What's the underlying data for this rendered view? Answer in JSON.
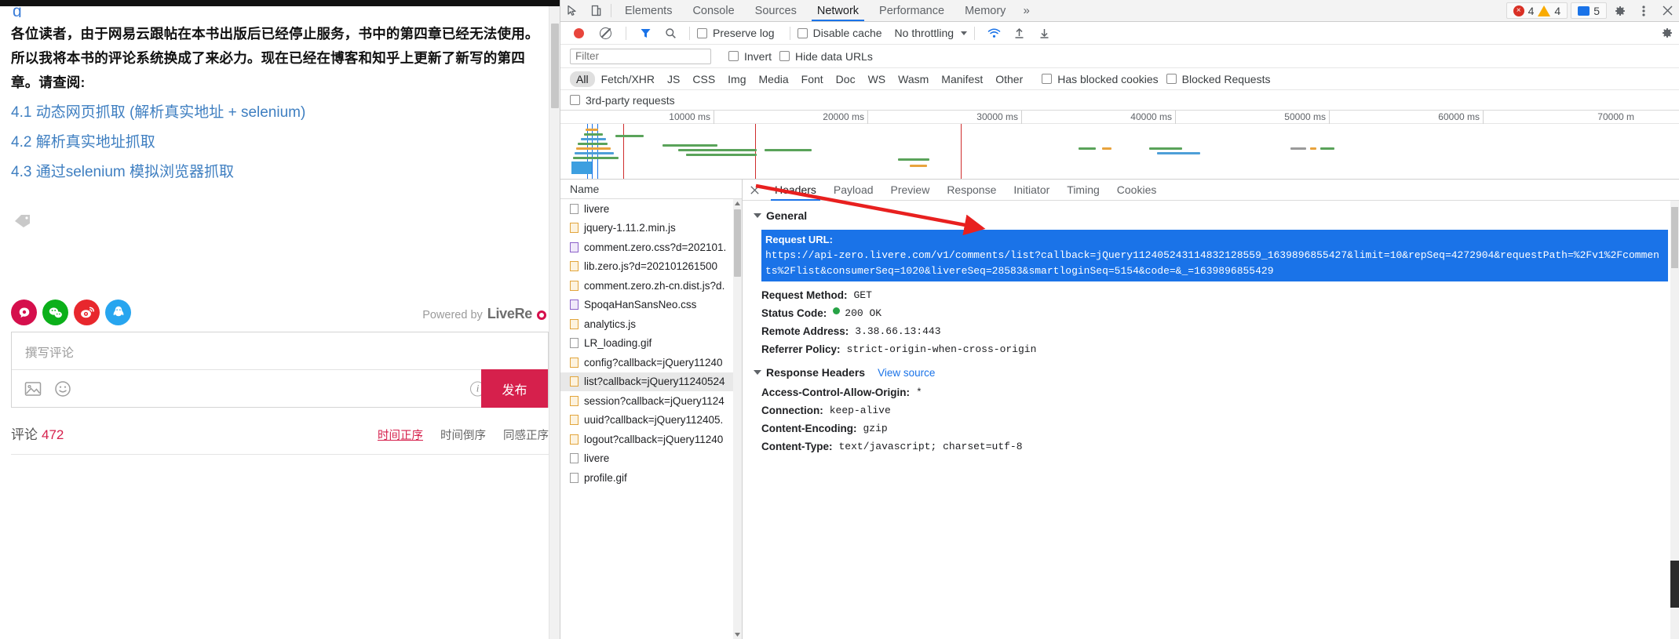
{
  "page": {
    "clipped_top_text": "g",
    "paragraph": "各位读者，由于网易云跟帖在本书出版后已经停止服务，书中的第四章已经无法使用。所以我将本书的评论系统换成了来必力。现在已经在博客和知乎上更新了新写的第四章。请查阅:",
    "toc": [
      "4.1 动态网页抓取 (解析真实地址 + selenium)",
      "4.2 解析真实地址抓取",
      "4.3 通过selenium 模拟浏览器抓取"
    ],
    "social_icons": [
      "livere-icon",
      "wechat-icon",
      "weibo-icon",
      "qq-icon"
    ],
    "powered_by": {
      "prefix": "Powered by",
      "brand": "LiveRe"
    },
    "composer": {
      "placeholder": "撰写评论",
      "tools": [
        "image-icon",
        "emoji-icon",
        "info-icon"
      ],
      "publish_label": "发布"
    },
    "comments": {
      "label": "评论",
      "count": "472",
      "sorts": [
        {
          "label": "时间正序",
          "active": true
        },
        {
          "label": "时间倒序",
          "active": false
        },
        {
          "label": "同感正序",
          "active": false
        }
      ]
    }
  },
  "devtools": {
    "tabs": [
      {
        "label": "Elements",
        "active": false
      },
      {
        "label": "Console",
        "active": false
      },
      {
        "label": "Sources",
        "active": false
      },
      {
        "label": "Network",
        "active": true
      },
      {
        "label": "Performance",
        "active": false
      },
      {
        "label": "Memory",
        "active": false
      }
    ],
    "more_label": "»",
    "counters": {
      "errors": "4",
      "warnings": "4",
      "messages": "5"
    },
    "icons": [
      "inspect-icon",
      "device-toolbar-icon",
      "settings-gear-icon",
      "kebab-menu-icon",
      "close-icon"
    ],
    "network_toolbar": {
      "record_label": "record-button",
      "clear_label": "clear-button",
      "filter_icon": "funnel-icon",
      "search_icon": "search-icon",
      "preserve_log": {
        "label": "Preserve log",
        "checked": false
      },
      "disable_cache": {
        "label": "Disable cache",
        "checked": false
      },
      "throttling": "No throttling",
      "extra_icons": [
        "wifi-icon",
        "import-har-icon",
        "export-har-icon"
      ]
    },
    "filter_bar": {
      "placeholder": "Filter",
      "value": "",
      "invert": {
        "label": "Invert",
        "checked": false
      },
      "hide_data_urls": {
        "label": "Hide data URLs",
        "checked": false
      }
    },
    "resource_types": [
      {
        "label": "All",
        "active": true
      },
      {
        "label": "Fetch/XHR",
        "active": false
      },
      {
        "label": "JS",
        "active": false
      },
      {
        "label": "CSS",
        "active": false
      },
      {
        "label": "Img",
        "active": false
      },
      {
        "label": "Media",
        "active": false
      },
      {
        "label": "Font",
        "active": false
      },
      {
        "label": "Doc",
        "active": false
      },
      {
        "label": "WS",
        "active": false
      },
      {
        "label": "Wasm",
        "active": false
      },
      {
        "label": "Manifest",
        "active": false
      },
      {
        "label": "Other",
        "active": false
      }
    ],
    "has_blocked_cookies": {
      "label": "Has blocked cookies",
      "checked": false
    },
    "blocked_requests": {
      "label": "Blocked Requests",
      "checked": false
    },
    "third_party": {
      "label": "3rd-party requests",
      "checked": false
    },
    "overview_ticks": [
      "10000 ms",
      "20000 ms",
      "30000 ms",
      "40000 ms",
      "50000 ms",
      "60000 ms",
      "70000 m"
    ],
    "request_list": {
      "header": "Name",
      "rows": [
        {
          "name": "livere",
          "kind": "doc",
          "selected": false
        },
        {
          "name": "jquery-1.11.2.min.js",
          "kind": "js",
          "selected": false
        },
        {
          "name": "comment.zero.css?d=202101.",
          "kind": "css",
          "selected": false
        },
        {
          "name": "lib.zero.js?d=202101261500",
          "kind": "js",
          "selected": false
        },
        {
          "name": "comment.zero.zh-cn.dist.js?d.",
          "kind": "js",
          "selected": false
        },
        {
          "name": "SpoqaHanSansNeo.css",
          "kind": "css",
          "selected": false
        },
        {
          "name": "analytics.js",
          "kind": "js",
          "selected": false
        },
        {
          "name": "LR_loading.gif",
          "kind": "doc",
          "selected": false
        },
        {
          "name": "config?callback=jQuery11240",
          "kind": "js",
          "selected": false
        },
        {
          "name": "list?callback=jQuery11240524",
          "kind": "js",
          "selected": true
        },
        {
          "name": "session?callback=jQuery1124",
          "kind": "js",
          "selected": false
        },
        {
          "name": "uuid?callback=jQuery112405.",
          "kind": "js",
          "selected": false
        },
        {
          "name": "logout?callback=jQuery11240",
          "kind": "js",
          "selected": false
        },
        {
          "name": "livere",
          "kind": "doc",
          "selected": false
        },
        {
          "name": "profile.gif",
          "kind": "doc",
          "selected": false
        }
      ]
    },
    "detail_tabs": [
      {
        "label": "Headers",
        "active": true
      },
      {
        "label": "Payload",
        "active": false
      },
      {
        "label": "Preview",
        "active": false
      },
      {
        "label": "Response",
        "active": false
      },
      {
        "label": "Initiator",
        "active": false
      },
      {
        "label": "Timing",
        "active": false
      },
      {
        "label": "Cookies",
        "active": false
      }
    ],
    "general": {
      "section_title": "General",
      "request_url_key": "Request URL:",
      "request_url_value": "https://api-zero.livere.com/v1/comments/list?callback=jQuery112405243114832128559_1639896855427&limit=10&repSeq=4272904&requestPath=%2Fv1%2Fcomments%2Flist&consumerSeq=1020&livereSeq=28583&smartloginSeq=5154&code=&_=1639896855429",
      "request_method_key": "Request Method:",
      "request_method_value": "GET",
      "status_code_key": "Status Code:",
      "status_code_value": "200 OK",
      "remote_address_key": "Remote Address:",
      "remote_address_value": "3.38.66.13:443",
      "referrer_policy_key": "Referrer Policy:",
      "referrer_policy_value": "strict-origin-when-cross-origin"
    },
    "response_headers": {
      "section_title": "Response Headers",
      "view_source": "View source",
      "rows": [
        {
          "key": "Access-Control-Allow-Origin:",
          "value": "*"
        },
        {
          "key": "Connection:",
          "value": "keep-alive"
        },
        {
          "key": "Content-Encoding:",
          "value": "gzip"
        },
        {
          "key": "Content-Type:",
          "value": "text/javascript; charset=utf-8"
        }
      ]
    },
    "annotation": {
      "type": "red-arrow",
      "points_to": "request-url-value"
    },
    "colors": {
      "accent": "#1a73e8",
      "error": "#d93025",
      "warning": "#f9ab00",
      "success": "#27a346",
      "brand_red": "#d6204c"
    }
  }
}
